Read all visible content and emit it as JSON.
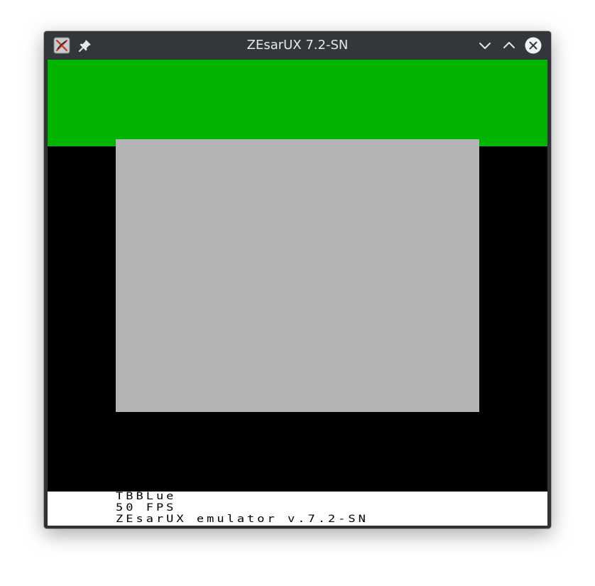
{
  "window": {
    "title": "ZEsarUX 7.2-SN"
  },
  "emulator": {
    "border_color": "#00b400",
    "paper_color": "#b4b4b4",
    "background_color": "#000000",
    "footer_background": "#ffffff",
    "footer_lines": [
      "TBBLue",
      "50 FPS",
      "ZEsarUX emulator v.7.2-SN"
    ]
  },
  "icons": {
    "app": "zesarux-app-icon",
    "pin": "pin-icon",
    "minimize": "chevron-down-icon",
    "maximize": "chevron-up-icon",
    "close": "close-icon"
  }
}
